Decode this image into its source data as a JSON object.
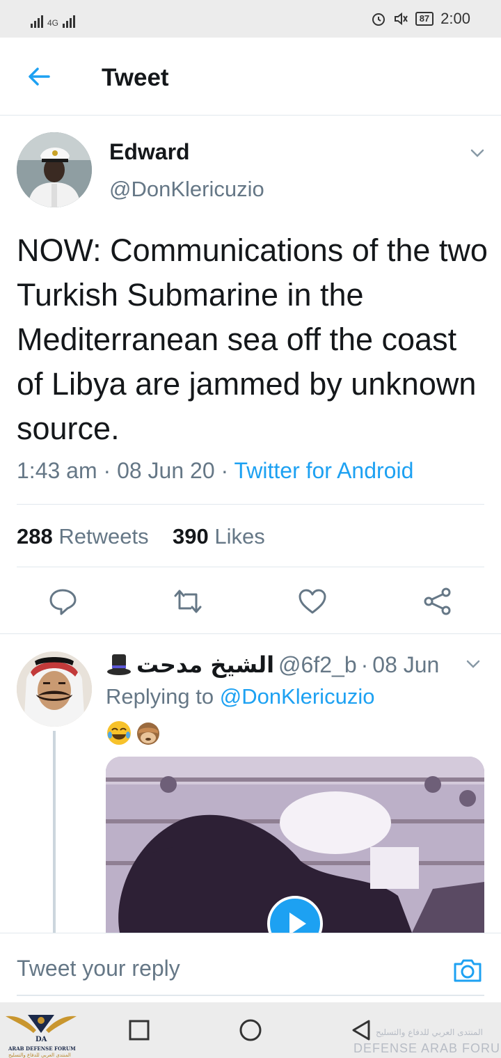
{
  "status_bar": {
    "signal_label": "4G",
    "battery": "87",
    "time": "2:00"
  },
  "header": {
    "title": "Tweet"
  },
  "tweet": {
    "author_name": "Edward",
    "author_handle": "@DonKlericuzio",
    "text": "NOW: Communications of the two Turkish Submarine in the Mediterranean sea off the coast of Libya are jammed by unknown source.",
    "time": "1:43 am",
    "date": "08 Jun 20",
    "source": "Twitter for Android",
    "separator": "·",
    "retweets_count": "288",
    "retweets_label": "Retweets",
    "likes_count": "390",
    "likes_label": "Likes"
  },
  "reply": {
    "author_name": "الشيخ مدحت",
    "author_handle": "@6f2_b",
    "separator": "·",
    "date": "08 Jun",
    "replying_prefix": "Replying to",
    "replying_to": "@DonKlericuzio"
  },
  "compose": {
    "placeholder": "Tweet your reply"
  },
  "watermark": {
    "logo_text": "ARAB DEFENSE FORUM",
    "logo_subtext": "المنتدى العربي للدفاع والتسليح",
    "overlay_arabic": "المنتدى العربي للدفاع والتسليح",
    "overlay_english": "DEFENSE ARAB FORUM"
  },
  "colors": {
    "accent": "#1da1f2",
    "secondary_text": "#657786",
    "primary_text": "#14171a",
    "divider": "#e1e8ed",
    "system_bar": "#ececec"
  },
  "icons": [
    "back-arrow-icon",
    "chevron-down-icon",
    "reply-icon",
    "retweet-icon",
    "like-icon",
    "share-icon",
    "top-hat-icon",
    "play-icon",
    "camera-icon",
    "nav-recents-icon",
    "nav-home-icon",
    "nav-back-icon"
  ]
}
